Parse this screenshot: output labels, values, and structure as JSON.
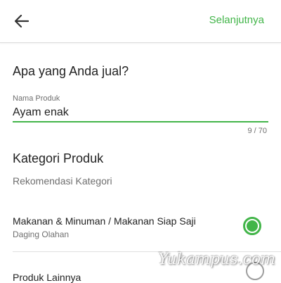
{
  "header": {
    "back_icon": "arrow-left-icon",
    "next_label": "Selanjutnya"
  },
  "product_section": {
    "title": "Apa yang Anda jual?",
    "name_field": {
      "label": "Nama Produk",
      "value": "Ayam enak",
      "counter": "9 / 70"
    }
  },
  "category_section": {
    "title": "Kategori Produk",
    "subtitle": "Rekomendasi Kategori",
    "options": [
      {
        "title": "Makanan & Minuman / Makanan Siap Saji",
        "subtitle": "Daging Olahan",
        "selected": true
      },
      {
        "title": "Produk Lainnya",
        "selected": false
      }
    ]
  },
  "watermark": "Yukampus.com",
  "colors": {
    "accent": "#42b549",
    "text_primary": "#222222",
    "text_secondary": "#6f6f6f"
  }
}
